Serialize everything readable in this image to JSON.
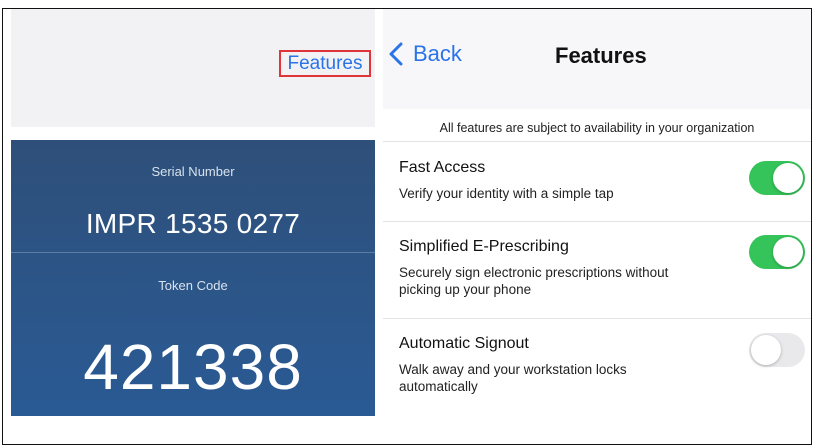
{
  "left_panel": {
    "features_link": "Features",
    "serial_label": "Serial Number",
    "serial_value": "IMPR 1535 0277",
    "token_label": "Token Code",
    "token_value": "421338"
  },
  "right_panel": {
    "back_label": "Back",
    "title": "Features",
    "note": "All features are subject to availability in your organization",
    "features": [
      {
        "title": "Fast Access",
        "description": "Verify your identity with a simple tap",
        "enabled": true
      },
      {
        "title": "Simplified E-Prescribing",
        "description": "Securely sign electronic prescriptions without picking up your phone",
        "enabled": true
      },
      {
        "title": "Automatic Signout",
        "description": "Walk away and your workstation locks automatically",
        "enabled": false
      }
    ]
  },
  "colors": {
    "accent_blue": "#2a73e8",
    "highlight_red": "#e0343a",
    "toggle_on": "#35c459",
    "token_card": "#2c5587"
  },
  "icons": {
    "back": "chevron-left-icon"
  }
}
